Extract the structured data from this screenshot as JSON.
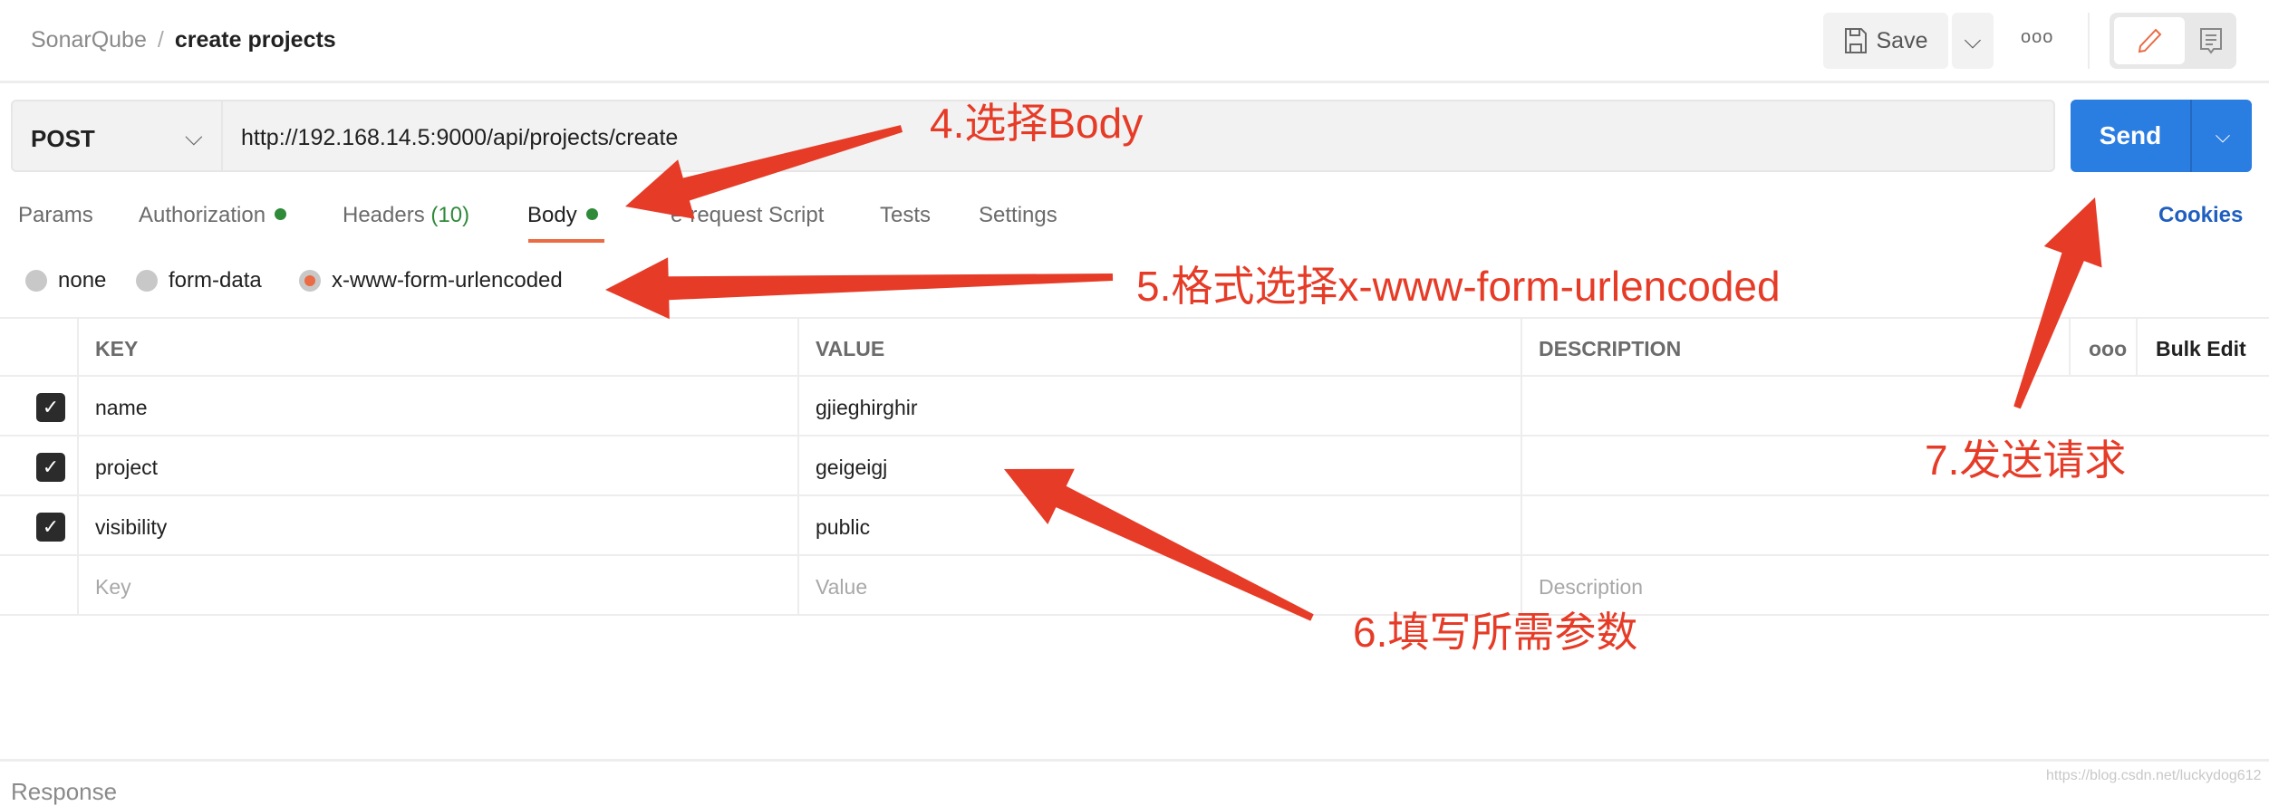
{
  "breadcrumb": {
    "parent": "SonarQube",
    "separator": "/",
    "current": "create projects"
  },
  "toolbar": {
    "save_label": "Save",
    "more": "ooo"
  },
  "request": {
    "method": "POST",
    "url": "http://192.168.14.5:9000/api/projects/create",
    "send_label": "Send"
  },
  "tabs": [
    {
      "label": "Params"
    },
    {
      "label": "Authorization"
    },
    {
      "label": "Headers",
      "count": "(10)"
    },
    {
      "label": "Body"
    },
    {
      "label": "e-request Script"
    },
    {
      "label": "Tests"
    },
    {
      "label": "Settings"
    }
  ],
  "cookies_label": "Cookies",
  "body_types": [
    {
      "label": "none",
      "selected": false
    },
    {
      "label": "form-data",
      "selected": false
    },
    {
      "label": "x-www-form-urlencoded",
      "selected": true
    }
  ],
  "table": {
    "headers": [
      "KEY",
      "VALUE",
      "DESCRIPTION"
    ],
    "bulk_edit": "Bulk Edit",
    "more": "ooo",
    "rows": [
      {
        "key": "name",
        "value": "gjieghirghir",
        "checked": true
      },
      {
        "key": "project",
        "value": "geigeigj",
        "checked": true
      },
      {
        "key": "visibility",
        "value": "public",
        "checked": true
      }
    ],
    "placeholders": {
      "key": "Key",
      "value": "Value",
      "description": "Description"
    }
  },
  "response_label": "Response",
  "watermark": "https://blog.csdn.net/luckydog612",
  "annotations": {
    "a4": "4.选择Body",
    "a5": "5.格式选择x-www-form-urlencoded",
    "a6": "6.填写所需参数",
    "a7": "7.发送请求"
  },
  "colors": {
    "accent": "#ea6b44",
    "send": "#2a7de1",
    "annotation": "#e63b27",
    "dot": "#2f8a3a"
  }
}
